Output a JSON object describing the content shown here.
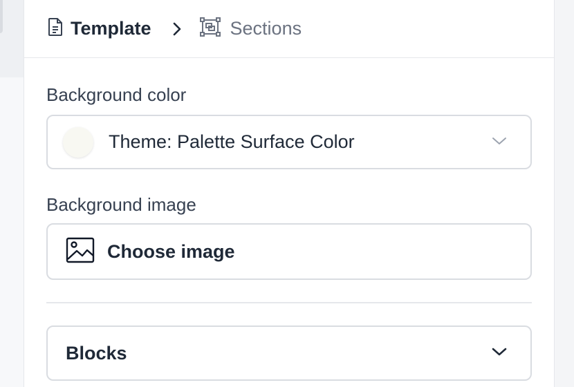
{
  "breadcrumb": {
    "items": [
      {
        "label": "Template",
        "icon": "document-icon"
      },
      {
        "label": "Sections",
        "icon": "sections-icon"
      }
    ]
  },
  "background_color": {
    "label": "Background color",
    "value": "Theme: Palette Surface Color",
    "swatch_color": "#f8f8f2"
  },
  "background_image": {
    "label": "Background image",
    "button_label": "Choose image"
  },
  "blocks": {
    "label": "Blocks"
  }
}
